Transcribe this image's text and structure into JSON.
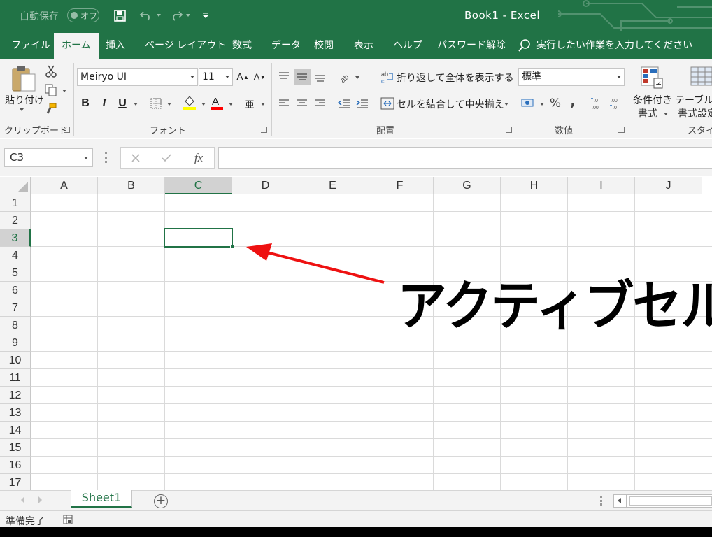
{
  "titlebar": {
    "autosave_label": "自動保存",
    "autosave_state": "オフ",
    "title": "Book1  -  Excel",
    "brand_color": "#217346",
    "icons": [
      "save-icon",
      "undo-icon",
      "redo-icon",
      "customize-qat-icon"
    ]
  },
  "tabs": [
    {
      "label": "ファイル",
      "active": false
    },
    {
      "label": "ホーム",
      "active": true
    },
    {
      "label": "挿入",
      "active": false
    },
    {
      "label": "ページ レイアウト",
      "active": false
    },
    {
      "label": "数式",
      "active": false
    },
    {
      "label": "データ",
      "active": false
    },
    {
      "label": "校閲",
      "active": false
    },
    {
      "label": "表示",
      "active": false
    },
    {
      "label": "ヘルプ",
      "active": false
    },
    {
      "label": "パスワード解除",
      "active": false
    }
  ],
  "tell_me": "実行したい作業を入力してください",
  "ribbon": {
    "clipboard": {
      "group_label": "クリップボード",
      "paste_label": "貼り付け"
    },
    "font": {
      "group_label": "フォント",
      "font_name": "Meiryo UI",
      "font_size": "11",
      "bold": "B",
      "italic": "I",
      "underline": "U",
      "fill_color": "#ffff00",
      "font_color": "#ff0000"
    },
    "alignment": {
      "group_label": "配置",
      "wrap_text": "折り返して全体を表示する",
      "merge_center": "セルを結合して中央揃え"
    },
    "number": {
      "group_label": "数値",
      "format": "標準",
      "percent": "%",
      "comma": ","
    },
    "styles": {
      "group_label": "スタイル",
      "conditional_line1": "条件付き",
      "conditional_line2": "書式",
      "table_line1": "テーブルと",
      "table_line2": "書式設定"
    }
  },
  "formula_bar": {
    "name_box": "C3",
    "fx": "fx",
    "formula": ""
  },
  "grid": {
    "columns": [
      "A",
      "B",
      "C",
      "D",
      "E",
      "F",
      "G",
      "H",
      "I",
      "J"
    ],
    "rows": [
      "1",
      "2",
      "3",
      "4",
      "5",
      "6",
      "7",
      "8",
      "9",
      "10",
      "11",
      "12",
      "13",
      "14",
      "15",
      "16",
      "17"
    ],
    "selected_column": "C",
    "selected_row": "3"
  },
  "annotation": {
    "text": "アクティブセル",
    "arrow_color": "#ee1111"
  },
  "sheets": {
    "tabs": [
      "Sheet1"
    ],
    "active": "Sheet1",
    "add_label": "+"
  },
  "status": {
    "ready": "準備完了"
  }
}
